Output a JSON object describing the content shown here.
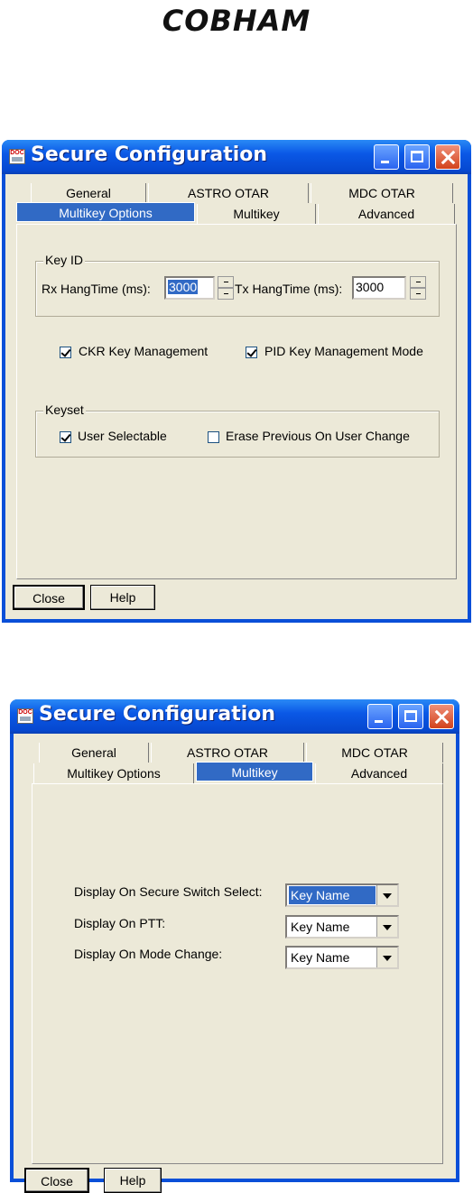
{
  "logo": {
    "text": "COBHAM"
  },
  "dialog1": {
    "title": "Secure Configuration",
    "tabs_row1": [
      "General",
      "ASTRO OTAR",
      "MDC OTAR"
    ],
    "tabs_row2": [
      "Multikey Options",
      "Multikey",
      "Advanced"
    ],
    "active_tab": "Multikey Options",
    "keyid_group": "Key ID",
    "rx_label": "Rx HangTime (ms):",
    "rx_value": "3000",
    "tx_label": "Tx HangTime (ms):",
    "tx_value": "3000",
    "ckr_label": "CKR Key Management",
    "ckr_checked": true,
    "pid_label": "PID Key Management Mode",
    "pid_checked": true,
    "keyset_group": "Keyset",
    "user_selectable_label": "User Selectable",
    "user_selectable_checked": true,
    "erase_label": "Erase Previous On User Change",
    "erase_checked": false,
    "close_button": "Close",
    "help_button": "Help"
  },
  "dialog2": {
    "title": "Secure Configuration",
    "tabs_row1": [
      "General",
      "ASTRO OTAR",
      "MDC OTAR"
    ],
    "tabs_row2": [
      "Multikey Options",
      "Multikey",
      "Advanced"
    ],
    "active_tab": "Multikey",
    "rows": [
      {
        "label": "Display On Secure Switch Select:",
        "value": "Key Name",
        "highlighted": true
      },
      {
        "label": "Display On PTT:",
        "value": "Key Name",
        "highlighted": false
      },
      {
        "label": "Display On Mode Change:",
        "value": "Key Name",
        "highlighted": false
      }
    ],
    "close_button": "Close",
    "help_button": "Help"
  }
}
